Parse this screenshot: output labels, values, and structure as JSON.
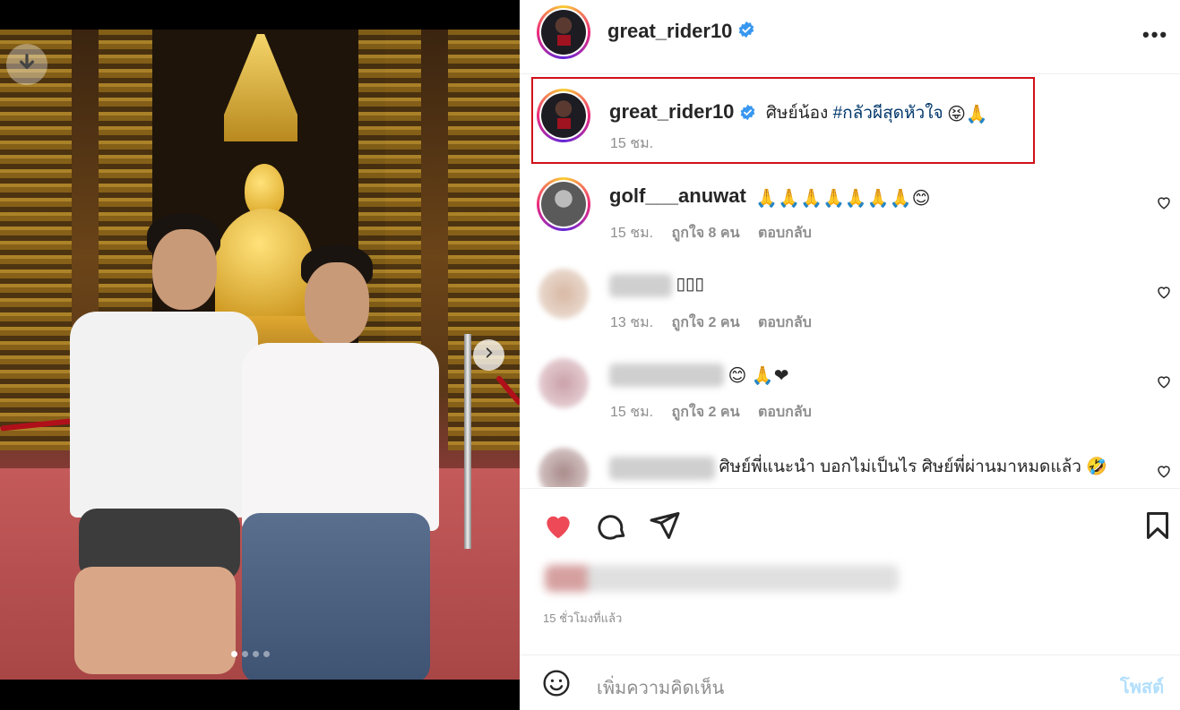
{
  "post": {
    "username": "great_rider10",
    "verified": true
  },
  "caption": {
    "username": "great_rider10",
    "text": "ศิษย์น้อง ",
    "hashtag": "#กลัวผีสุดหัวใจ",
    "emojis": "😝🙏",
    "time": "15 ชม."
  },
  "comments": [
    {
      "username": "golf___anuwat",
      "text": "🙏🙏🙏🙏🙏🙏🙏😊",
      "time": "15 ชม.",
      "likes": "ถูกใจ 8 คน",
      "reply": "ตอบกลับ"
    },
    {
      "username": "",
      "text": "▯▯▯",
      "time": "13 ชม.",
      "likes": "ถูกใจ 2 คน",
      "reply": "ตอบกลับ"
    },
    {
      "username": "",
      "text": "😊 🙏❤",
      "time": "15 ชม.",
      "likes": "ถูกใจ 2 คน",
      "reply": "ตอบกลับ"
    },
    {
      "username": "",
      "text": "ศิษย์พี่แนะนำ บอกไม่เป็นไร ศิษย์พี่ผ่านมาหมดแล้ว 🤣",
      "time": "",
      "likes": "",
      "reply": ""
    }
  ],
  "footer": {
    "time_ago": "15 ชั่วโมงที่แล้ว",
    "add_comment_placeholder": "เพิ่มความคิดเห็น",
    "post_label": "โพสต์"
  },
  "carousel": {
    "total_slides": 4,
    "active_slide": 1
  },
  "colors": {
    "liked_heart": "#ed4956",
    "verified_badge": "#3897f0",
    "highlight_box": "#d0101a",
    "post_button": "#b2dffc"
  },
  "icons": [
    "download-icon",
    "chevron-right-icon",
    "verified-icon",
    "more-icon",
    "heart-icon",
    "comment-icon",
    "share-icon",
    "bookmark-icon",
    "emoji-icon"
  ]
}
